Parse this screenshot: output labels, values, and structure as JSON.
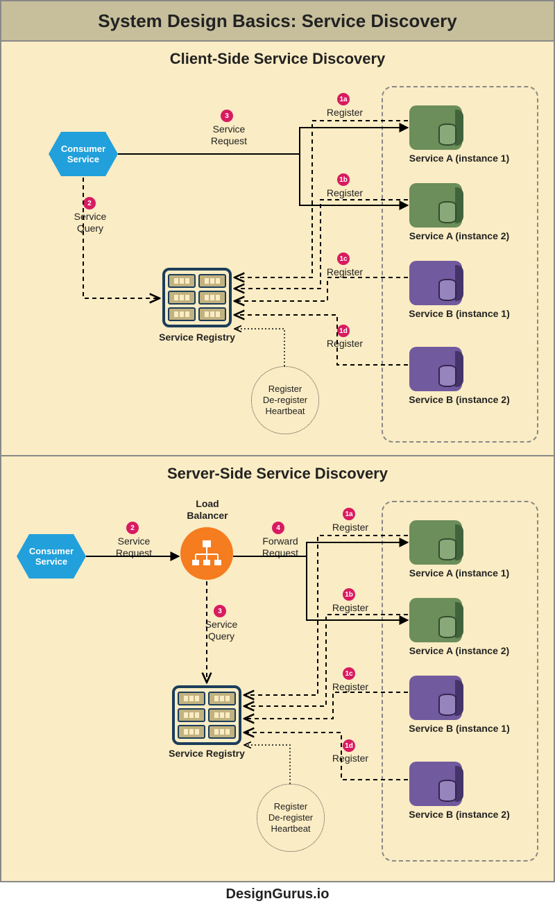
{
  "title": "System Design Basics: Service Discovery",
  "footer": "DesignGurus.io",
  "panels": {
    "client": {
      "heading": "Client-Side Service Discovery",
      "consumer": "Consumer\nService",
      "registry_label": "Service Registry",
      "bubble": [
        "Register",
        "De-register",
        "Heartbeat"
      ],
      "steps": {
        "s1a": {
          "badge": "1a",
          "text": "Register"
        },
        "s1b": {
          "badge": "1b",
          "text": "Register"
        },
        "s1c": {
          "badge": "1c",
          "text": "Register"
        },
        "s1d": {
          "badge": "1d",
          "text": "Register"
        },
        "s2": {
          "badge": "2",
          "text": "Service\nQuery"
        },
        "s3": {
          "badge": "3",
          "text": "Service\nRequest"
        }
      },
      "services": [
        {
          "label": "Service A (instance 1)",
          "variant": "green"
        },
        {
          "label": "Service A (instance 2)",
          "variant": "green"
        },
        {
          "label": "Service B (instance 1)",
          "variant": "purple"
        },
        {
          "label": "Service B (instance 2)",
          "variant": "purple"
        }
      ]
    },
    "server": {
      "heading": "Server-Side Service Discovery",
      "consumer": "Consumer\nService",
      "lb_label": "Load\nBalancer",
      "registry_label": "Service Registry",
      "bubble": [
        "Register",
        "De-register",
        "Heartbeat"
      ],
      "steps": {
        "s1a": {
          "badge": "1a",
          "text": "Register"
        },
        "s1b": {
          "badge": "1b",
          "text": "Register"
        },
        "s1c": {
          "badge": "1c",
          "text": "Register"
        },
        "s1d": {
          "badge": "1d",
          "text": "Register"
        },
        "s2": {
          "badge": "2",
          "text": "Service\nRequest"
        },
        "s3": {
          "badge": "3",
          "text": "Service\nQuery"
        },
        "s4": {
          "badge": "4",
          "text": "Forward\nRequest"
        }
      },
      "services": [
        {
          "label": "Service A (instance 1)",
          "variant": "green"
        },
        {
          "label": "Service A (instance 2)",
          "variant": "green"
        },
        {
          "label": "Service B (instance 1)",
          "variant": "purple"
        },
        {
          "label": "Service B (instance 2)",
          "variant": "purple"
        }
      ]
    }
  }
}
